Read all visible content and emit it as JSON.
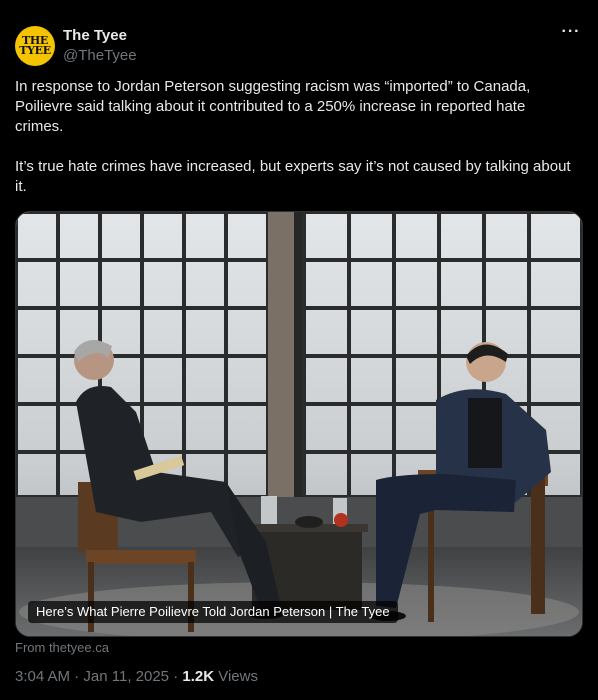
{
  "author": {
    "avatar_line1": "THE",
    "avatar_line2": "TYEE",
    "display_name": "The Tyee",
    "handle": "@TheTyee"
  },
  "more_label": "···",
  "post": {
    "paragraph1": "In response to Jordan Peterson suggesting racism was “imported” to Canada, Poilievre said talking about it contributed to a 250% increase in reported hate crimes.",
    "paragraph2": "It’s true hate crimes have increased, but experts say it’s not caused by talking about it."
  },
  "media": {
    "caption": "Here’s What Pierre Poilievre Told Jordan Peterson | The Tyee"
  },
  "link_source": "From thetyee.ca",
  "meta": {
    "time": "3:04 AM",
    "date": "Jan 11, 2025",
    "views_count": "1.2K",
    "views_label": "Views",
    "separator": "·"
  },
  "colors": {
    "background": "#000000",
    "text_primary": "#e7e9ea",
    "text_secondary": "#71767b",
    "avatar_bg": "#f5c400"
  }
}
